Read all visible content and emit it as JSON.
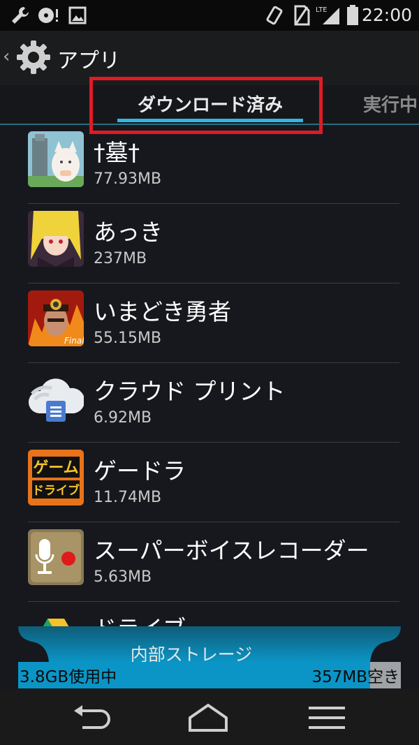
{
  "status_bar": {
    "time": "22:00",
    "icons": [
      "wrench-icon",
      "disc-alert-icon",
      "image-icon",
      "rotate-icon",
      "no-sim-icon",
      "lte-signal-icon",
      "battery-icon"
    ],
    "lte": "LTE"
  },
  "action_bar": {
    "title": "アプリ",
    "icon": "settings-gear-icon"
  },
  "tabs": {
    "active": "ダウンロード済み",
    "next": "実行中"
  },
  "apps": [
    {
      "name": "†墓†",
      "size": "77.93MB",
      "icon": "graveyard-cat-icon"
    },
    {
      "name": "あっき",
      "size": "237MB",
      "icon": "anime-girl-icon"
    },
    {
      "name": "いまどき勇者",
      "size": "55.15MB",
      "icon": "hero-final-icon"
    },
    {
      "name": "クラウド プリント",
      "size": "6.92MB",
      "icon": "cloud-print-icon"
    },
    {
      "name": "ゲードラ",
      "size": "11.74MB",
      "icon": "game-drive-icon"
    },
    {
      "name": "スーパーボイスレコーダー",
      "size": "5.63MB",
      "icon": "voice-recorder-icon"
    },
    {
      "name": "ドライブ",
      "size": "",
      "icon": "google-drive-icon"
    }
  ],
  "game_drive_icon_text": {
    "line1": "ゲーム",
    "line2": "ドライブ"
  },
  "storage": {
    "label": "内部ストレージ",
    "used": "3.8GB使用中",
    "free": "357MB空き",
    "used_fraction": 0.92
  },
  "nav": [
    "back-icon",
    "home-icon",
    "recent-apps-icon"
  ],
  "colors": {
    "accent": "#33b5e5",
    "highlight": "#e01b24",
    "storage_bar": "#0b95c6"
  }
}
